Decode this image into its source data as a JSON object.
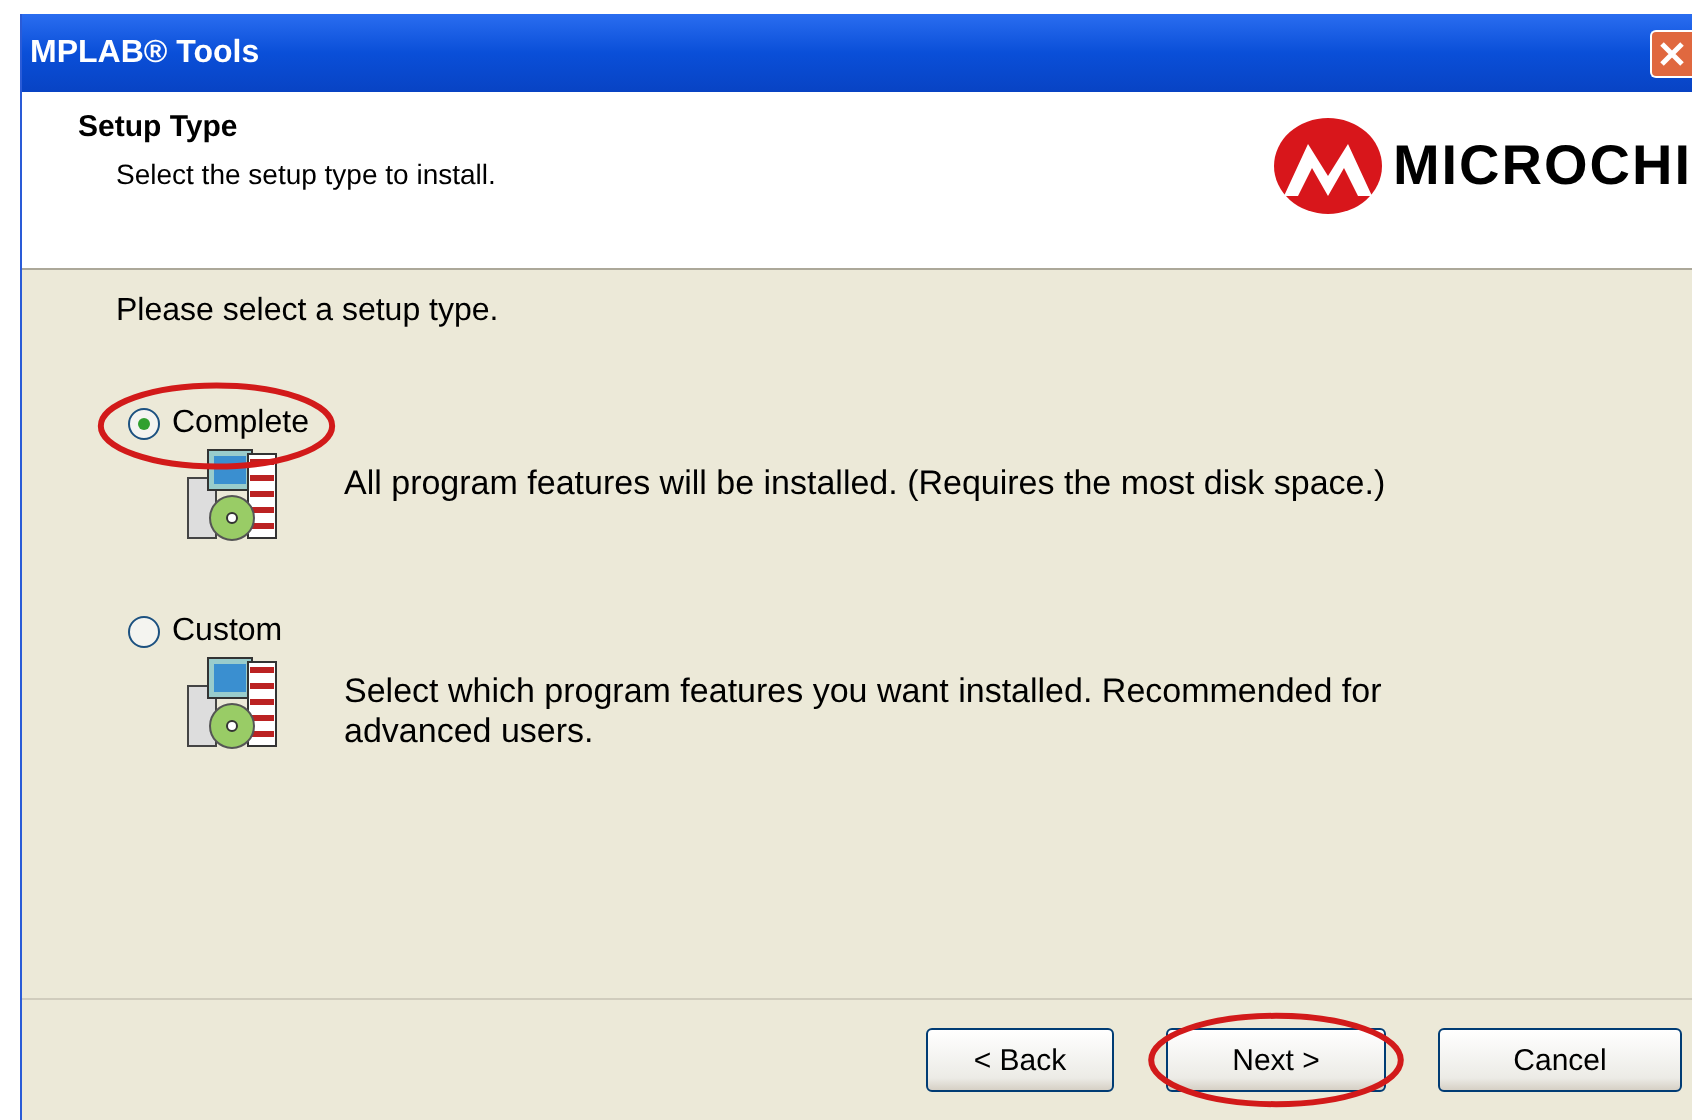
{
  "window": {
    "title": "MPLAB® Tools"
  },
  "header": {
    "title": "Setup Type",
    "subtitle": "Select the setup type to install.",
    "logo_text": "MICROCHI"
  },
  "prompt": "Please select a setup type.",
  "options": [
    {
      "label": "Complete",
      "description": "All program features will be installed. (Requires the most disk space.)",
      "selected": true,
      "circled": true
    },
    {
      "label": "Custom",
      "description": "Select which program features you want installed. Recommended for advanced users.",
      "selected": false,
      "circled": false
    }
  ],
  "buttons": [
    {
      "label": "< Back",
      "circled": false
    },
    {
      "label": "Next >",
      "circled": true
    },
    {
      "label": "Cancel",
      "circled": false
    }
  ]
}
